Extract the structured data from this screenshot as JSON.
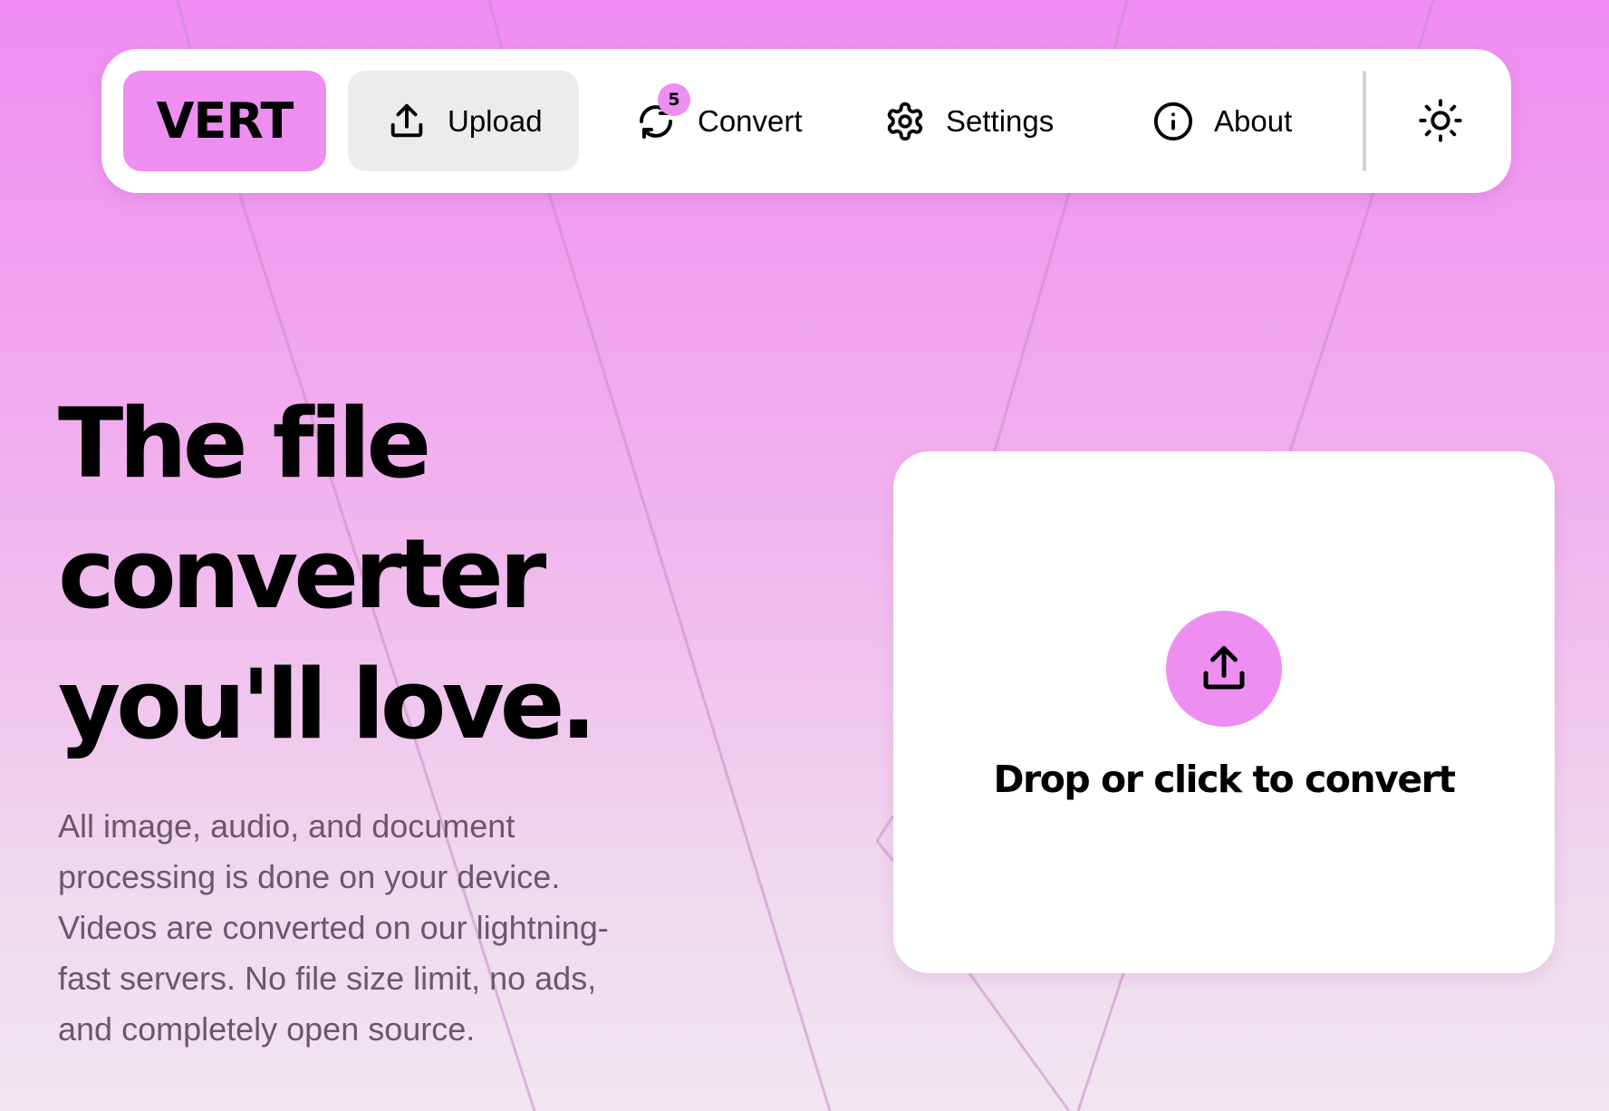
{
  "nav": {
    "brand": "VERT",
    "items": [
      {
        "label": "Upload",
        "icon": "upload-icon",
        "active": true
      },
      {
        "label": "Convert",
        "icon": "refresh-icon",
        "badge": "5"
      },
      {
        "label": "Settings",
        "icon": "gear-icon"
      },
      {
        "label": "About",
        "icon": "info-icon"
      }
    ],
    "theme_toggle_icon": "sun-icon"
  },
  "hero": {
    "title_lines": [
      "The file",
      "converter",
      "you'll love."
    ],
    "description_lines": [
      "All image, audio, and document",
      "processing is done on your device.",
      "Videos are converted on our lightning-",
      "fast servers. No file size limit, no ads,",
      "and completely open source."
    ]
  },
  "dropzone": {
    "icon": "upload-icon",
    "label": "Drop or click to convert"
  },
  "colors": {
    "accent": "#ee8ef0",
    "active_nav_bg": "#ececec",
    "description_text": "#6d566d"
  }
}
